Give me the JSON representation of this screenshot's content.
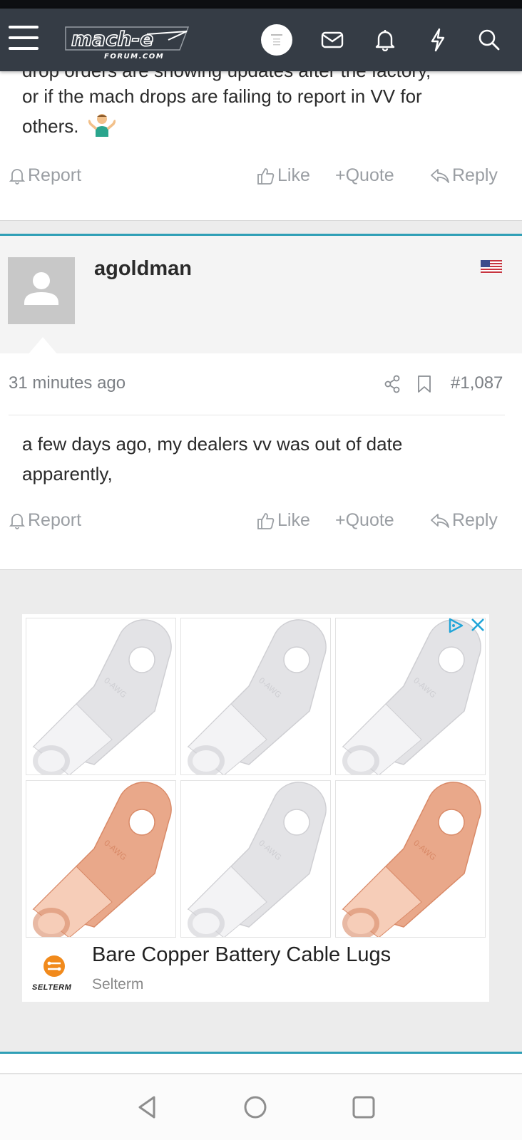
{
  "header": {
    "logo_text": "mach-e",
    "logo_subtext": "FORUM.COM",
    "icons": [
      "menu-icon",
      "avatar-icon",
      "envelope-icon",
      "bell-icon",
      "bolt-icon",
      "search-icon"
    ]
  },
  "post_prev": {
    "cut_line": "drop orders are showing updates after the factory,",
    "line2": "or if the mach drops are failing to report in VV for",
    "line3": "others.",
    "actions": {
      "report": "Report",
      "like": "Like",
      "quote": "+Quote",
      "reply": "Reply"
    }
  },
  "post": {
    "username": "agoldman",
    "time": "31 minutes ago",
    "number": "#1,087",
    "line1": "a few days ago, my dealers vv was out of date",
    "line2": "apparently,",
    "actions": {
      "report": "Report",
      "like": "Like",
      "quote": "+Quote",
      "reply": "Reply"
    }
  },
  "ad": {
    "title": "Bare Copper Battery Cable Lugs",
    "brand": "Selterm",
    "logo_text": "SELTERM",
    "lug_text": "0-AWG"
  },
  "colors": {
    "header_bg": "#353c45",
    "accent": "#2f9fb6",
    "action_gray": "#9a9ea3",
    "copper": "#e9a88a",
    "silver": "#e3e3e6"
  }
}
